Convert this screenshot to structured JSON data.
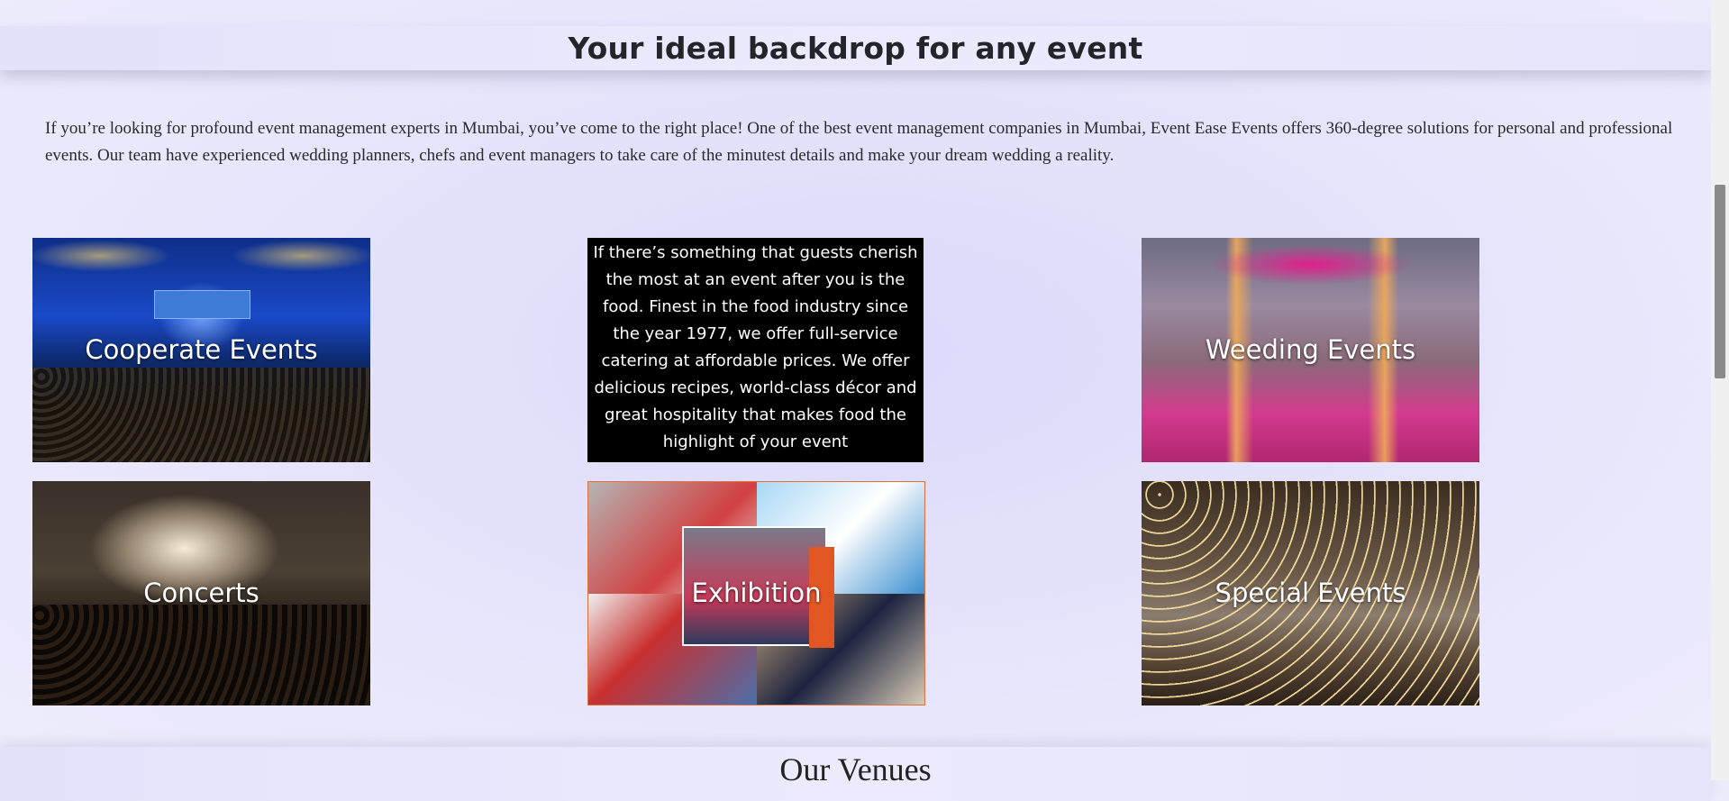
{
  "section": {
    "title": "Your ideal backdrop for any event",
    "intro": "If you’re looking for profound event management experts in Mumbai, you’ve come to the right place! One of the best event management companies in Mumbai, Event Ease Events offers 360-degree solutions for personal and professional events. Our team have experienced wedding planners, chefs and event managers to take care of the minutest details and make your dream wedding a reality."
  },
  "cards": {
    "corporate": "Cooperate Events",
    "food_text": "If there’s something that guests cherish the most at an event after you is the food. Finest in the food industry since the year 1977, we offer full-service catering at affordable prices. We offer delicious recipes, world-class décor and great hospitality that makes food the highlight of your event",
    "wedding": "Weeding Events",
    "concerts": "Concerts",
    "exhibition": "Exhibition",
    "special": "Special Events"
  },
  "next_section": {
    "title": "Our Venues"
  },
  "colors": {
    "background": "#e2e0fb",
    "heading": "#24252b",
    "text_panel": "#000000"
  }
}
